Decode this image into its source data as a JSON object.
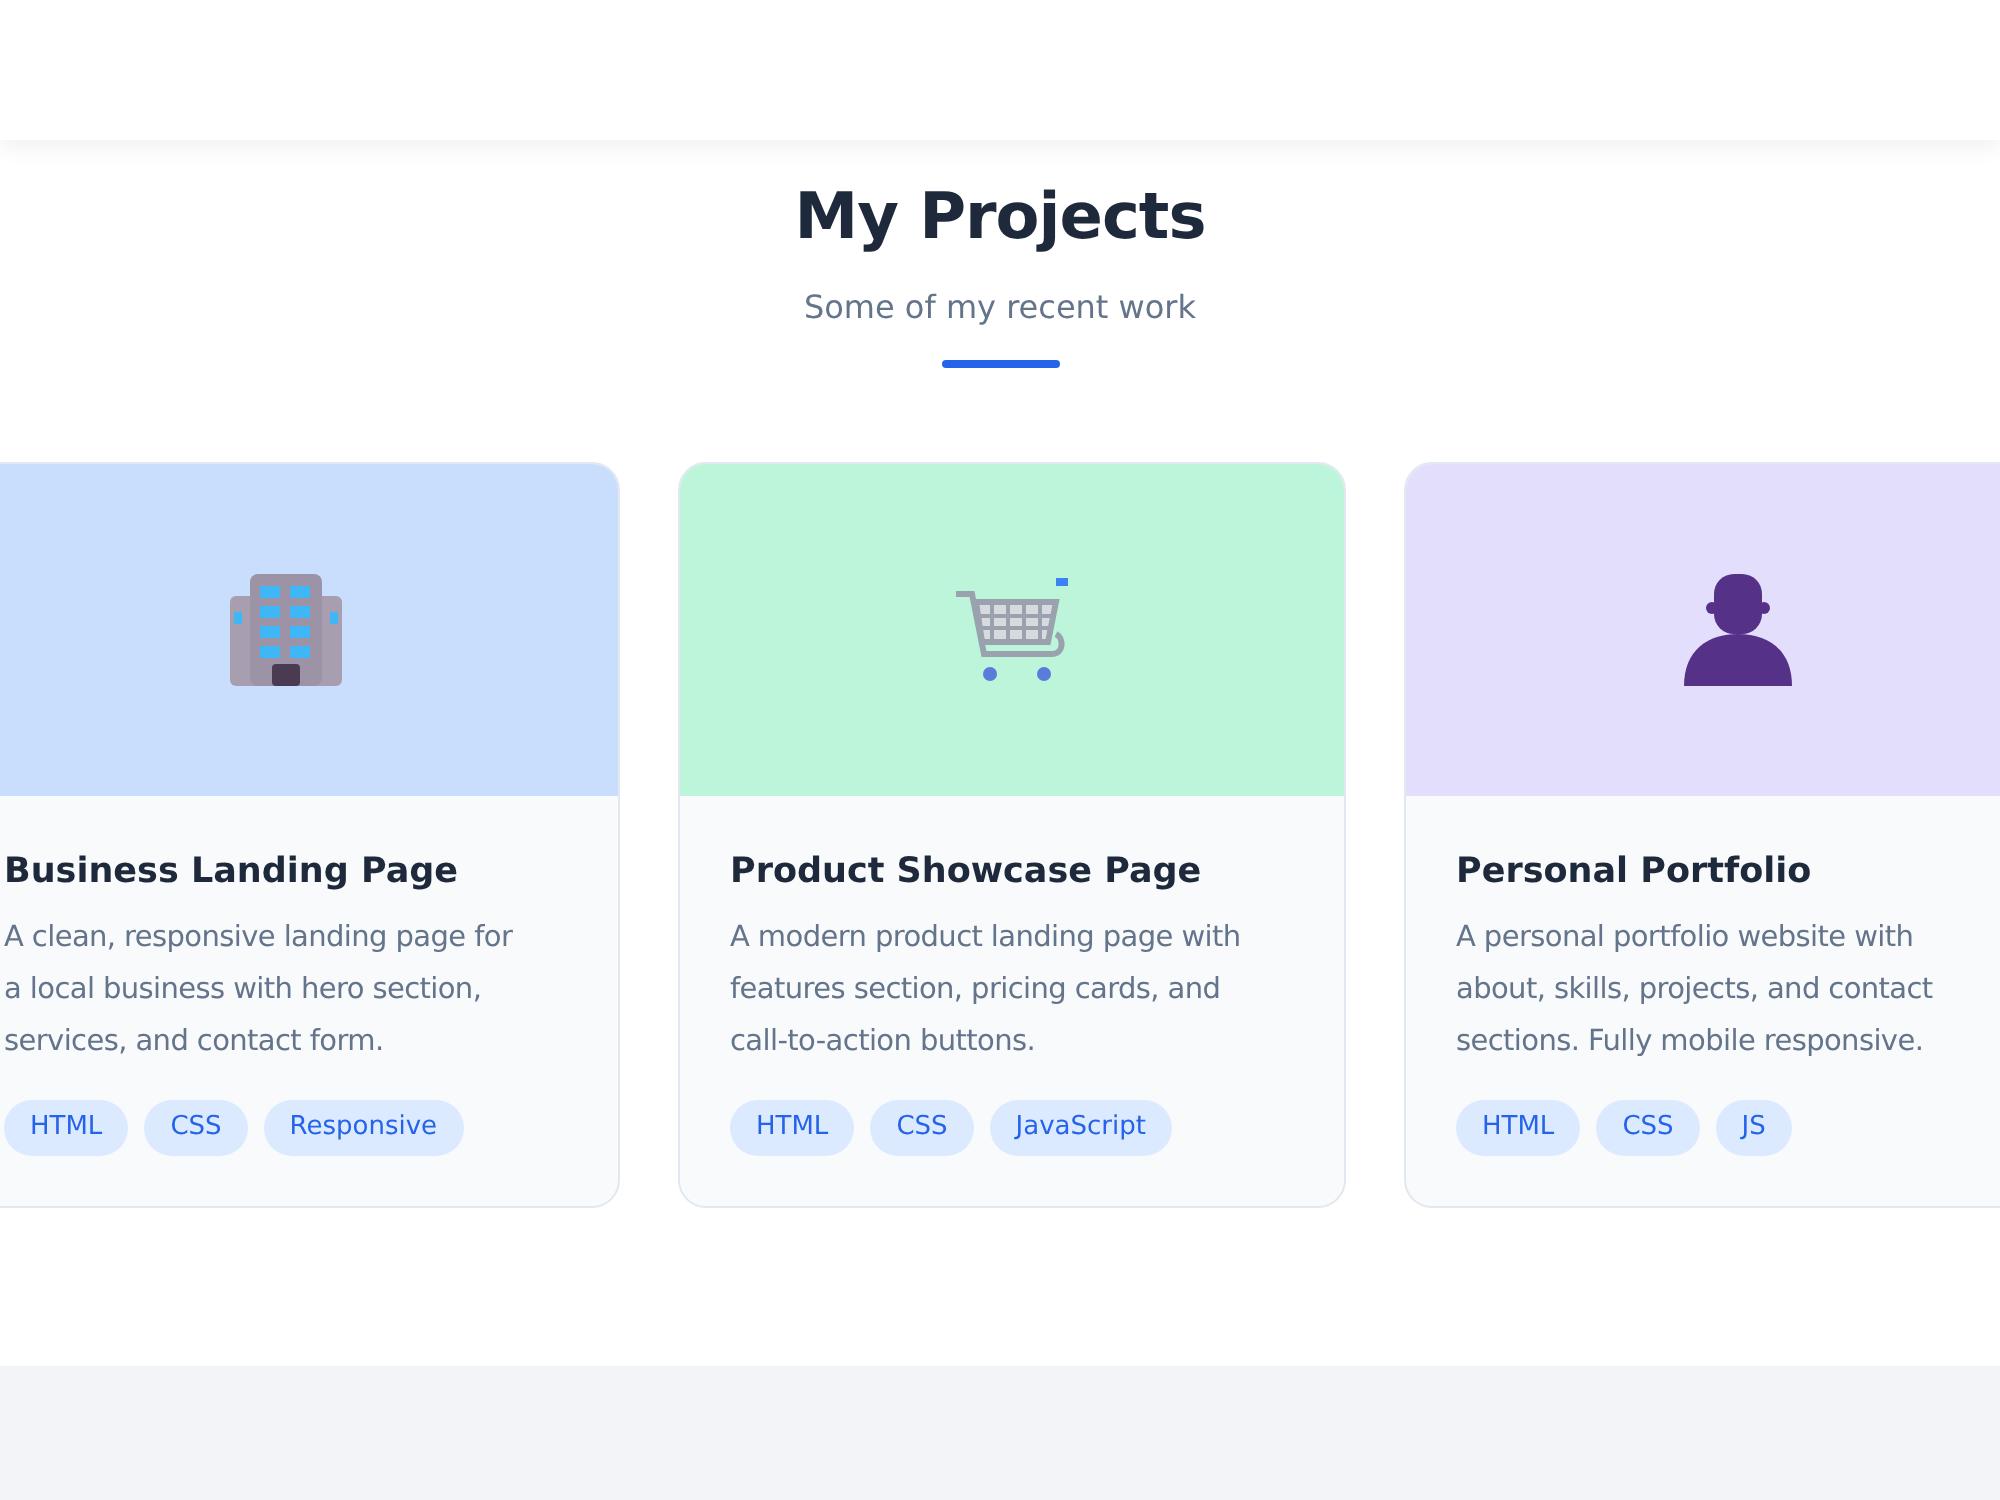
{
  "section": {
    "title": "My Projects",
    "subtitle": "Some of my recent work"
  },
  "projects": [
    {
      "title": "Business Landing Page",
      "description": "A clean, responsive landing page for a local business with hero section, services, and contact form.",
      "kind": "building",
      "color": "#c8defc",
      "tags": [
        "HTML",
        "CSS",
        "Responsive"
      ]
    },
    {
      "title": "Product Showcase Page",
      "description": "A modern product landing page with features section, pricing cards, and call-to-action buttons.",
      "kind": "cart",
      "color": "#bdf5db",
      "tags": [
        "HTML",
        "CSS",
        "JavaScript"
      ]
    },
    {
      "title": "Personal Portfolio",
      "description": "A personal portfolio website with about, skills, projects, and contact sections. Fully mobile responsive.",
      "kind": "person",
      "color": "#e4defd",
      "tags": [
        "HTML",
        "CSS",
        "JS"
      ]
    }
  ]
}
